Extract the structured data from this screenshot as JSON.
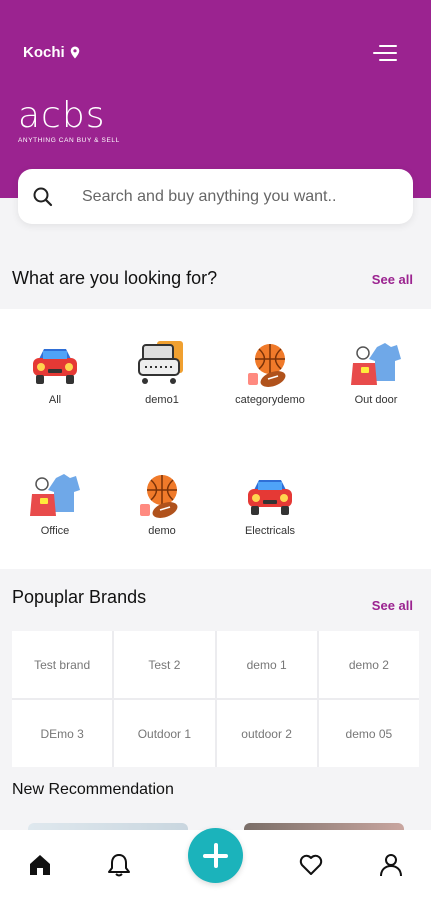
{
  "colors": {
    "brand": "#9b2390",
    "accent": "#9b2390",
    "fab": "#1bb3bb"
  },
  "header": {
    "location": "Kochi",
    "location_icon": "location-pin-icon",
    "menu_icon": "hamburger-menu-icon",
    "logo_text": "acbs",
    "logo_tagline": "ANYTHING CAN BUY & SELL"
  },
  "search": {
    "placeholder": "Search and buy anything you want..",
    "icon": "search-icon"
  },
  "categories": {
    "title": "What are you looking for?",
    "see_all": "See all",
    "items": [
      {
        "label": "All",
        "icon": "car-icon"
      },
      {
        "label": "demo1",
        "icon": "sofa-icon"
      },
      {
        "label": "categorydemo",
        "icon": "sports-balls-icon"
      },
      {
        "label": "Out door",
        "icon": "clothes-bag-icon"
      },
      {
        "label": "Office",
        "icon": "clothes-bag-icon"
      },
      {
        "label": "demo",
        "icon": "sports-balls-icon"
      },
      {
        "label": "Electricals",
        "icon": "car-icon"
      }
    ]
  },
  "brands": {
    "title": "Popuplar Brands",
    "see_all": "See all",
    "items": [
      "Test brand",
      "Test 2",
      "demo 1",
      "demo 2",
      "DEmo 3",
      "Outdoor 1",
      "outdoor 2",
      "demo 05"
    ]
  },
  "recommendation": {
    "title": "New Recommendation"
  },
  "bottom_nav": {
    "items": [
      "home-icon",
      "notification-bell-icon",
      "add-icon",
      "favorite-heart-icon",
      "profile-user-icon"
    ]
  }
}
